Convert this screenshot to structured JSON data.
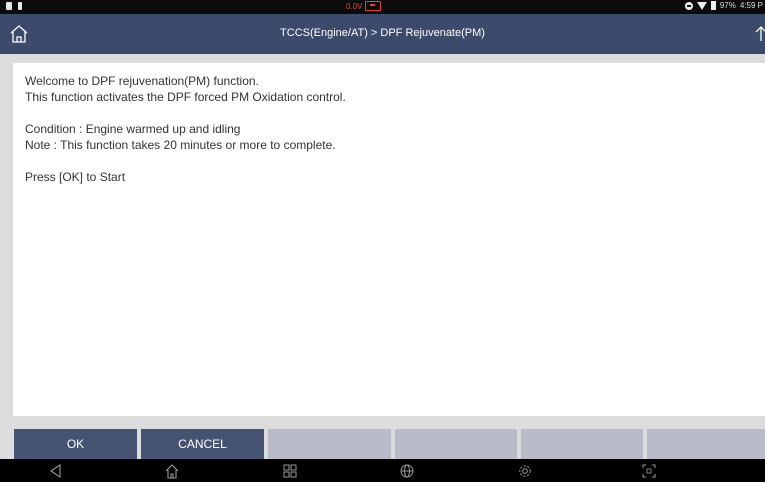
{
  "status_bar": {
    "voltage": "0.0V",
    "battery_percent": "97%",
    "time": "4:59 P"
  },
  "header": {
    "title": "TCCS(Engine/AT) > DPF Rejuvenate(PM)",
    "home_icon": "home-icon",
    "export_icon": "upload-icon"
  },
  "content": {
    "lines": [
      "Welcome to DPF rejuvenation(PM) function.",
      "This function activates the DPF forced PM Oxidation control.",
      "Condition : Engine warmed up and idling",
      "Note : This function takes 20 minutes or more to complete.",
      "Press [OK] to Start"
    ]
  },
  "buttons": {
    "ok_label": "OK",
    "cancel_label": "CANCEL"
  },
  "nav_icons": [
    "back-icon",
    "home-icon",
    "recent-apps-icon",
    "browser-icon",
    "settings-icon",
    "screenshot-icon"
  ],
  "colors": {
    "header_bg": "#3c4a6b",
    "active_button": "#465272",
    "inactive_button": "#b7bcc8",
    "voltage_warning": "#e0463d"
  }
}
